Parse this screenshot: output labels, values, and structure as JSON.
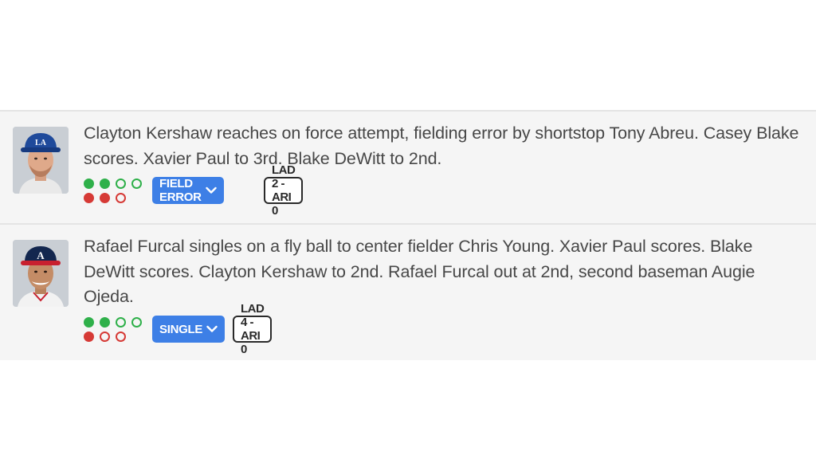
{
  "plays": [
    {
      "player_avatar": "player-headshot-dodgers",
      "description": "Clayton Kershaw reaches on force attempt, fielding error by shortstop Tony Abreu. Casey Blake scores. Xavier Paul to 3rd. Blake DeWitt to 2nd.",
      "balls": 2,
      "outs": 2,
      "result_label": "FIELD ERROR",
      "score": "LAD 2 - ARI 0"
    },
    {
      "player_avatar": "player-headshot-braves",
      "description": "Rafael Furcal singles on a fly ball to center fielder Chris Young. Xavier Paul scores. Blake DeWitt scores. Clayton Kershaw to 2nd. Rafael Furcal out at 2nd, second baseman Augie Ojeda.",
      "balls": 2,
      "outs": 1,
      "result_label": "SINGLE",
      "score": "LAD 4 - ARI 0"
    }
  ],
  "colors": {
    "ball": "#2fb04a",
    "out": "#d63a36",
    "result_pill": "#3d7fe6",
    "text": "#474747"
  },
  "icons": {
    "dropdown": "chevron-down-icon"
  }
}
